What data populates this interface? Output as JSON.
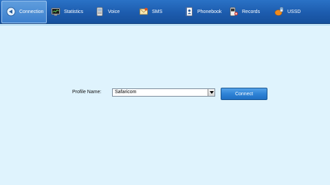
{
  "toolbar": {
    "tabs": [
      {
        "label": "Connection",
        "icon": "connection-icon",
        "active": true
      },
      {
        "label": "Statistics",
        "icon": "statistics-icon"
      },
      {
        "label": "Voice",
        "icon": "phone-icon"
      },
      {
        "label": "SMS",
        "icon": "envelope-icon"
      },
      {
        "label": "Phonebook",
        "icon": "phonebook-icon"
      },
      {
        "label": "Records",
        "icon": "records-icon"
      },
      {
        "label": "USSD",
        "icon": "ussd-icon"
      }
    ]
  },
  "profile": {
    "label": "Profile Name:",
    "selected": "Safaricom"
  },
  "actions": {
    "connect_label": "Connect"
  },
  "colors": {
    "toolbar": "#1d5cae",
    "background": "#dff3fd",
    "button": "#2f83d6"
  }
}
